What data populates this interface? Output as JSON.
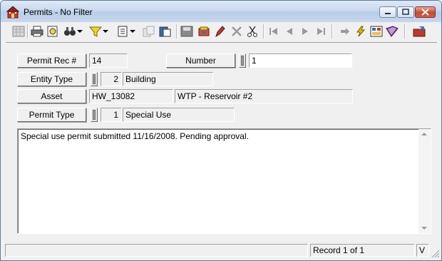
{
  "window": {
    "title": "Permits - No Filter"
  },
  "toolbar": {
    "icons": [
      "grid-icon",
      "print-icon",
      "print-preview-icon",
      "binoculars-icon",
      "filter-icon",
      "new-document-icon",
      "copy-icon",
      "paste-icon",
      "save-icon",
      "undo-icon",
      "edit-pencil-icon",
      "delete-icon",
      "cut-icon",
      "first-record-icon",
      "previous-record-icon",
      "next-record-icon",
      "last-record-icon",
      "goto-icon",
      "lightning-icon",
      "report-icon",
      "book-icon",
      "exit-icon"
    ]
  },
  "form": {
    "permit_rec": {
      "label": "Permit Rec #",
      "value": "14"
    },
    "number": {
      "label": "Number",
      "value": "1"
    },
    "entity_type": {
      "label": "Entity Type",
      "code": "2",
      "name": "Building"
    },
    "asset": {
      "label": "Asset",
      "id": "HW_13082",
      "description": "WTP - Reservoir #2"
    },
    "permit_type": {
      "label": "Permit Type",
      "code": "1",
      "name": "Special Use"
    },
    "notes": "Special use permit submitted 11/16/2008.  Pending approval."
  },
  "status": {
    "record": "Record 1 of 1",
    "mode": "V"
  }
}
